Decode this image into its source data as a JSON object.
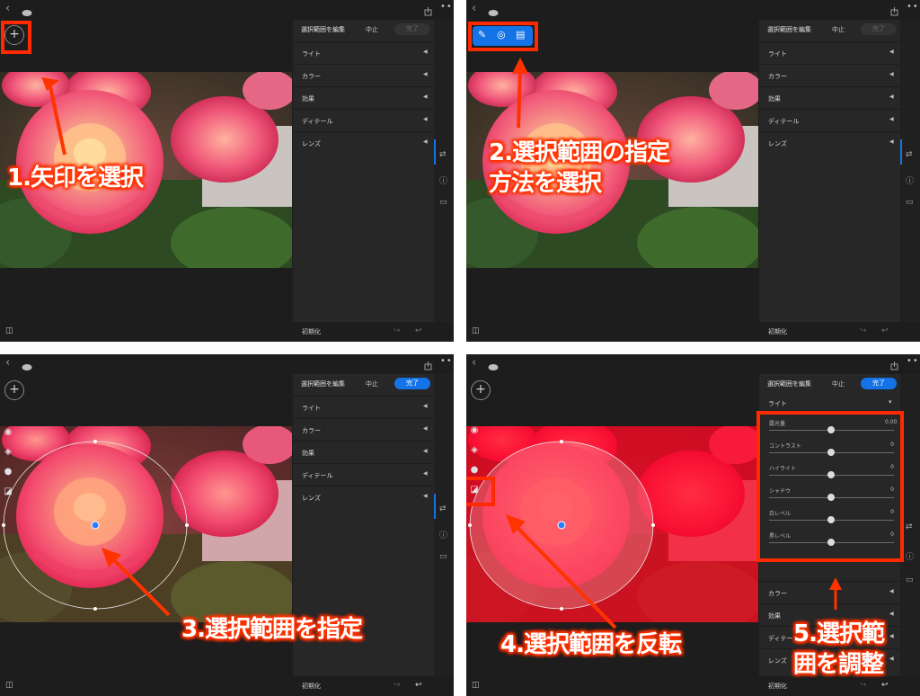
{
  "ui": {
    "title": "選択範囲を編集",
    "cancel": "中止",
    "done": "完了",
    "reset": "初期化",
    "sections": [
      "ライト",
      "カラー",
      "効果",
      "ディテール",
      "レンズ"
    ],
    "plus": "+"
  },
  "sliders": [
    {
      "label": "露光量",
      "value": "0.00"
    },
    {
      "label": "コントラスト",
      "value": "0"
    },
    {
      "label": "ハイライト",
      "value": "0"
    },
    {
      "label": "シャドウ",
      "value": "0"
    },
    {
      "label": "白レベル",
      "value": "0"
    },
    {
      "label": "黒レベル",
      "value": "0"
    }
  ],
  "steps": {
    "s1": "1.矢印を選択",
    "s2": "2.選択範囲の指定\n方法を選択",
    "s3": "3.選択範囲を指定",
    "s4": "4.選択範囲を反転",
    "s5": "5.選択範\n囲を調整"
  },
  "colors": {
    "accent": "#1473e6",
    "highlight": "#ff2a00",
    "panel_bg": "#272727"
  }
}
